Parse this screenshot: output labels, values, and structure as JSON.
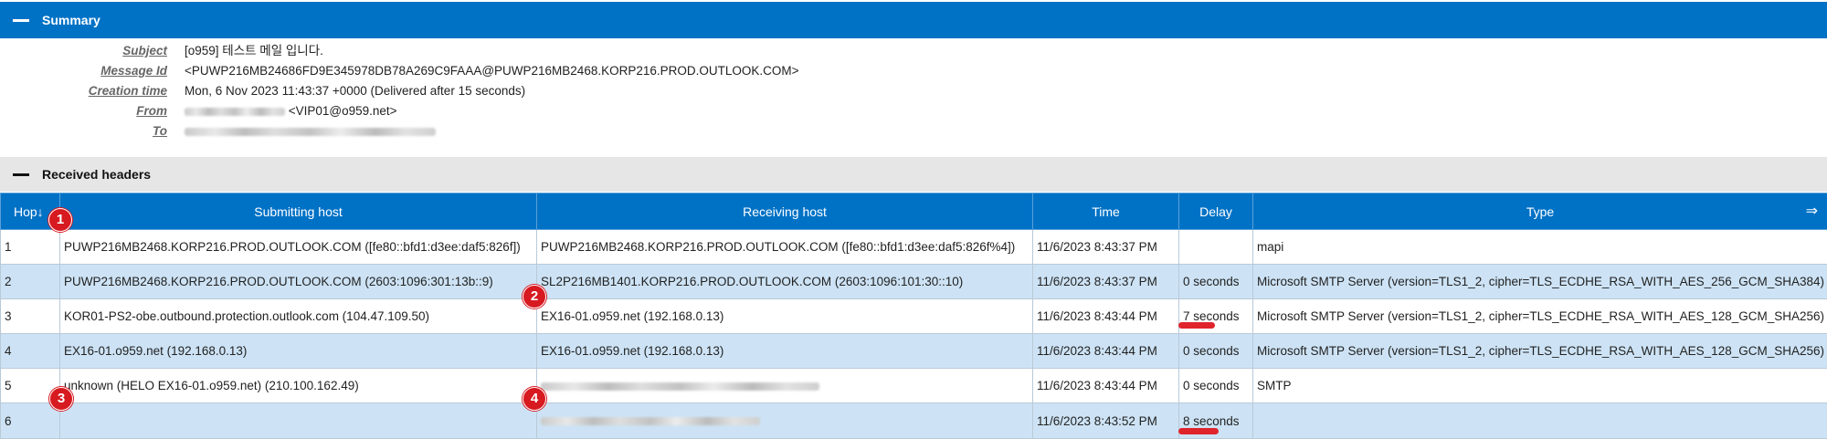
{
  "summary_section": {
    "title": "Summary",
    "fields": [
      {
        "label": "Subject",
        "value": "[o959] 테스트 메일 입니다."
      },
      {
        "label": "Message Id",
        "value": "<PUWP216MB24686FD9E345978DB78A269C9FAAA@PUWP216MB2468.KORP216.PROD.OUTLOOK.COM>"
      },
      {
        "label": "Creation time",
        "value": "Mon, 6 Nov 2023 11:43:37 +0000 (Delivered after 15 seconds)"
      },
      {
        "label": "From",
        "value": "<VIP01@o959.net>"
      },
      {
        "label": "To",
        "value": ""
      }
    ]
  },
  "received_section": {
    "title": "Received headers",
    "columns": [
      "Hop↓",
      "Submitting host",
      "Receiving host",
      "Time",
      "Delay",
      "Type"
    ],
    "expand_icon": "⇒",
    "rows": [
      {
        "hop": "1",
        "submitting": "PUWP216MB2468.KORP216.PROD.OUTLOOK.COM ([fe80::bfd1:d3ee:daf5:826f])",
        "receiving": "PUWP216MB2468.KORP216.PROD.OUTLOOK.COM ([fe80::bfd1:d3ee:daf5:826f%4])",
        "time": "11/6/2023 8:43:37 PM",
        "delay": "",
        "type": "mapi"
      },
      {
        "hop": "2",
        "submitting": "PUWP216MB2468.KORP216.PROD.OUTLOOK.COM (2603:1096:301:13b::9)",
        "receiving": "SL2P216MB1401.KORP216.PROD.OUTLOOK.COM (2603:1096:101:30::10)",
        "time": "11/6/2023 8:43:37 PM",
        "delay": "0 seconds",
        "type": "Microsoft SMTP Server (version=TLS1_2, cipher=TLS_ECDHE_RSA_WITH_AES_256_GCM_SHA384)"
      },
      {
        "hop": "3",
        "submitting": "KOR01-PS2-obe.outbound.protection.outlook.com (104.47.109.50)",
        "receiving": "EX16-01.o959.net (192.168.0.13)",
        "time": "11/6/2023 8:43:44 PM",
        "delay": "7 seconds",
        "type": "Microsoft SMTP Server (version=TLS1_2, cipher=TLS_ECDHE_RSA_WITH_AES_128_GCM_SHA256)"
      },
      {
        "hop": "4",
        "submitting": "EX16-01.o959.net (192.168.0.13)",
        "receiving": "EX16-01.o959.net (192.168.0.13)",
        "time": "11/6/2023 8:43:44 PM",
        "delay": "0 seconds",
        "type": "Microsoft SMTP Server (version=TLS1_2, cipher=TLS_ECDHE_RSA_WITH_AES_128_GCM_SHA256)"
      },
      {
        "hop": "5",
        "submitting": "unknown (HELO EX16-01.o959.net) (210.100.162.49)",
        "receiving": "",
        "time": "11/6/2023 8:43:44 PM",
        "delay": "0 seconds",
        "type": "SMTP"
      },
      {
        "hop": "6",
        "submitting": "",
        "receiving": "",
        "time": "11/6/2023 8:43:52 PM",
        "delay": "8 seconds",
        "type": ""
      }
    ]
  },
  "markers": [
    "1",
    "2",
    "3",
    "4"
  ],
  "colors": {
    "header_blue": "#0072c6",
    "row_alt": "#cde3f5",
    "marker_red": "#d71920"
  }
}
